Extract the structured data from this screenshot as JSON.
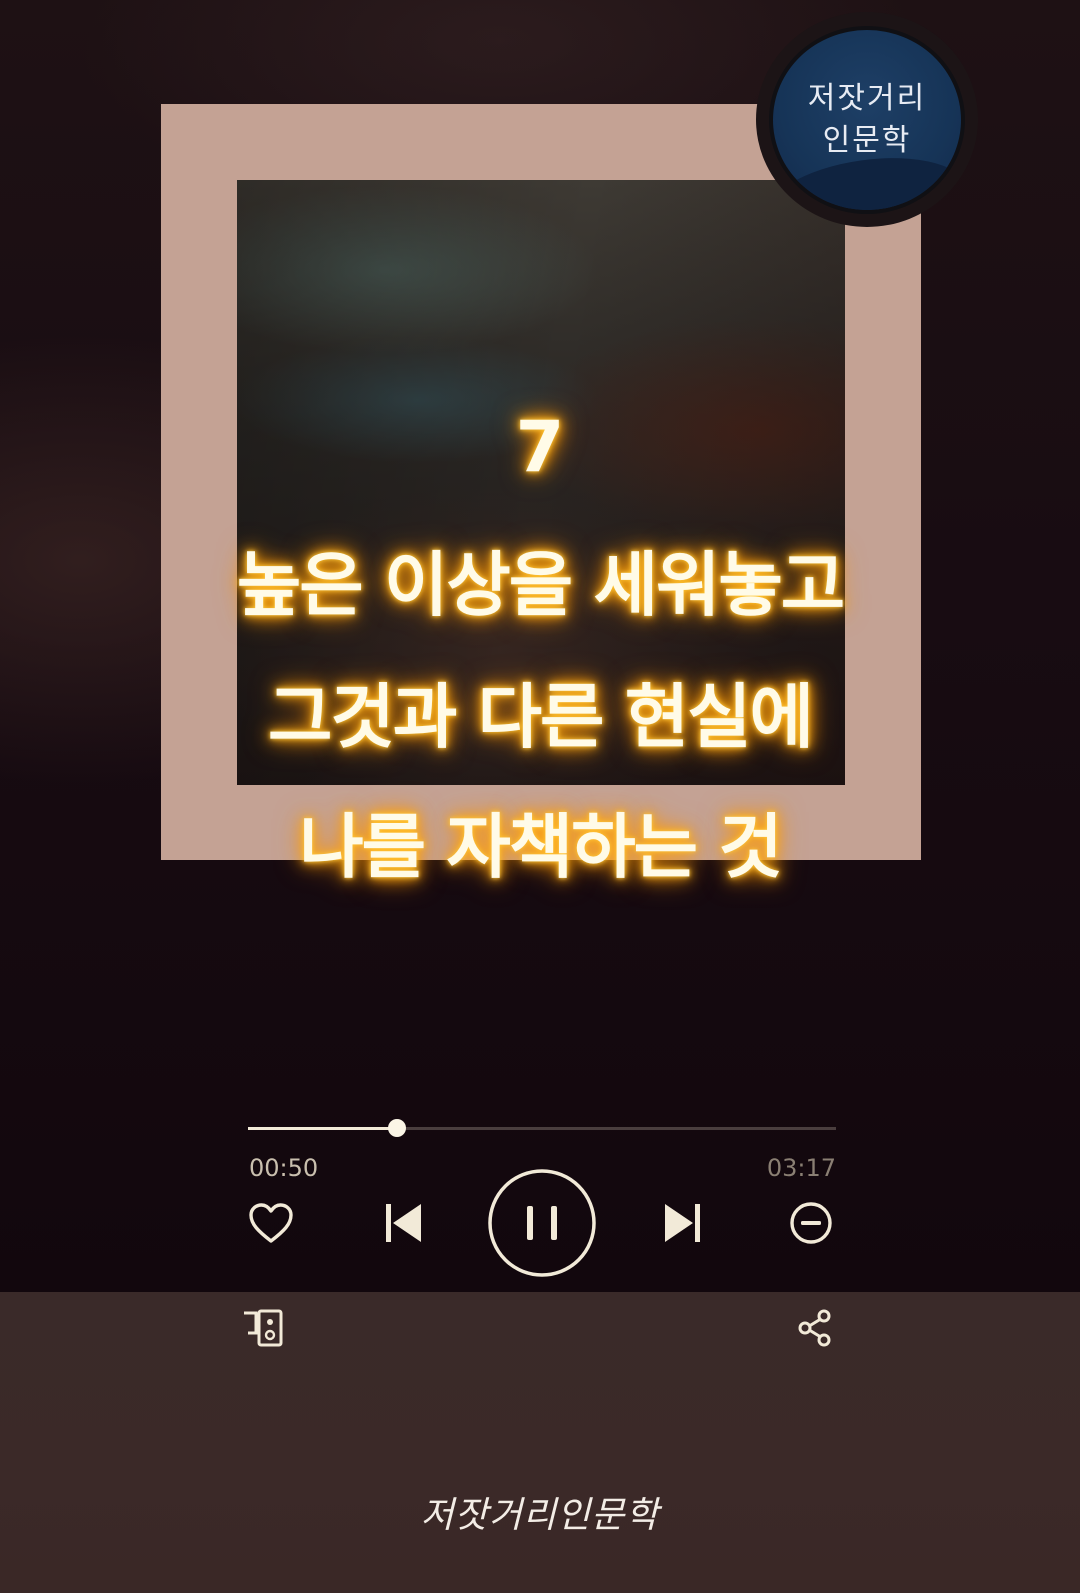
{
  "badge": {
    "line1": "저잣거리",
    "line2": "인문학"
  },
  "lyrics": {
    "number": "7",
    "line1": "높은 이상을 세워놓고",
    "line2": "그것과 다른 현실에",
    "line3": "나를 자책하는 것"
  },
  "player": {
    "elapsed": "00:50",
    "total": "03:17",
    "progress_fraction": 0.253,
    "is_playing": true
  },
  "icons": {
    "like": "heart-icon",
    "previous": "skip-previous-icon",
    "play_pause": "pause-icon",
    "next": "skip-next-icon",
    "remove": "minus-circle-icon",
    "device": "device-connect-icon",
    "share": "share-icon"
  },
  "watermark": "저잣거리인문학",
  "colors": {
    "frame": "#c4a294",
    "lyric_glow": "#ffb21f",
    "control": "#f2ead8",
    "badge_blue": "#1e3f66"
  }
}
